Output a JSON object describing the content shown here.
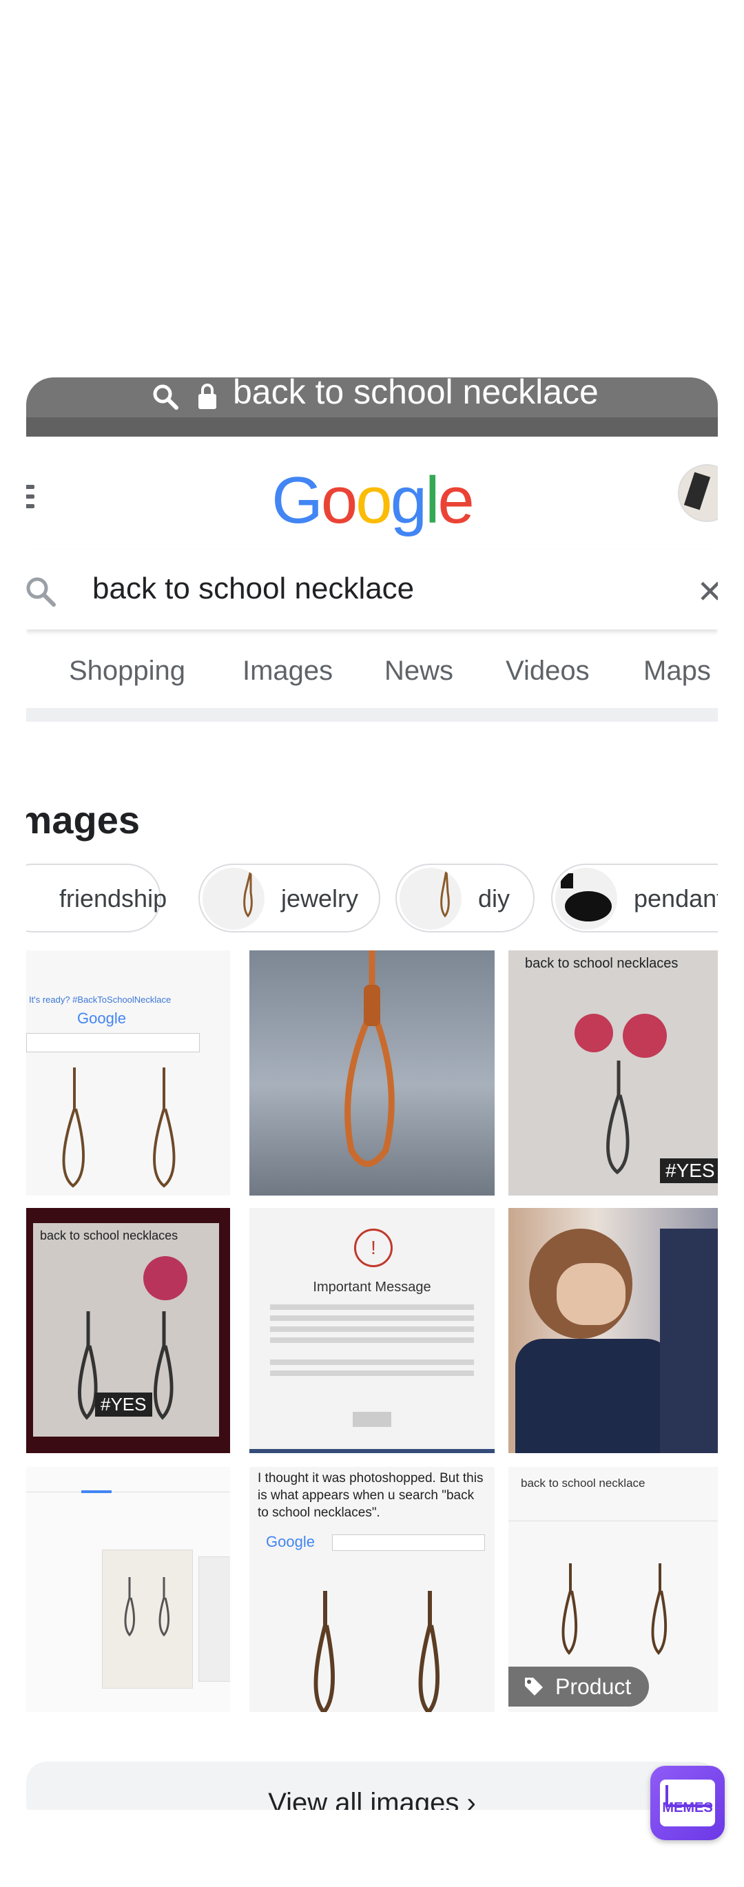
{
  "browser": {
    "url": "back to school necklace"
  },
  "google": {
    "logo_letters": [
      {
        "c": "G",
        "color": "#4285F4"
      },
      {
        "c": "o",
        "color": "#EA4335"
      },
      {
        "c": "o",
        "color": "#FBBC05"
      },
      {
        "c": "g",
        "color": "#4285F4"
      },
      {
        "c": "l",
        "color": "#34A853"
      },
      {
        "c": "e",
        "color": "#EA4335"
      }
    ],
    "query": "back to school necklace"
  },
  "tabs": [
    "Shopping",
    "Images",
    "News",
    "Videos",
    "Maps"
  ],
  "images_section": {
    "title": "Images",
    "chips": [
      "friendship",
      "jewelry",
      "diy",
      "pendant"
    ],
    "grid": [
      {
        "kind": "screenshot",
        "text": "It's ready? #BackToSchoolNecklace"
      },
      {
        "kind": "noose-sky"
      },
      {
        "kind": "photo",
        "text": "back to school necklaces"
      },
      {
        "kind": "photo-dark",
        "text": "back to school necklaces"
      },
      {
        "kind": "message",
        "text": "Important Message"
      },
      {
        "kind": "girl"
      },
      {
        "kind": "screenshot2"
      },
      {
        "kind": "meme",
        "text": "I thought it was photoshopped. But this is what appears when u search \"back to school necklaces\"."
      },
      {
        "kind": "product",
        "text": "back to school necklace",
        "badge": "Product"
      }
    ],
    "view_all": "View all images"
  },
  "watermark": {
    "label": "MEMES"
  },
  "colors": {
    "urlbar": "#757575",
    "tab_text": "#5f6368",
    "chip_border": "#dadce0",
    "watermark": "#7c4dff"
  }
}
